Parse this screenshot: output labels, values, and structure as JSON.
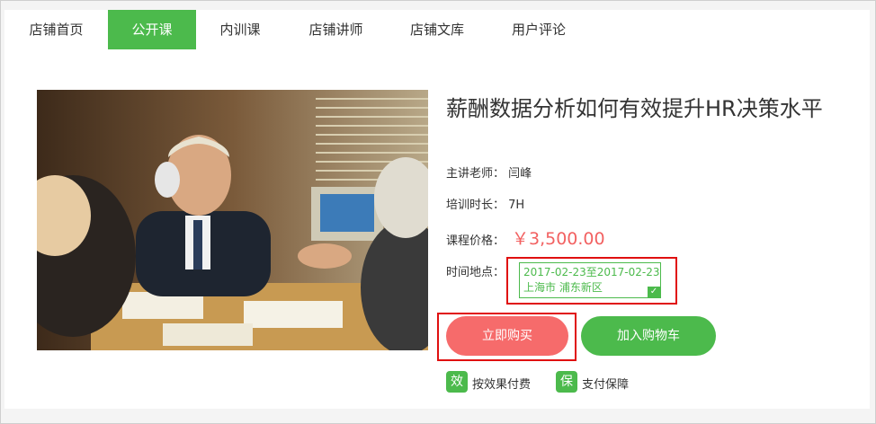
{
  "nav": {
    "tabs": [
      {
        "label": "店铺首页"
      },
      {
        "label": "公开课"
      },
      {
        "label": "内训课"
      },
      {
        "label": "店铺讲师"
      },
      {
        "label": "店铺文库"
      },
      {
        "label": "用户评论"
      }
    ],
    "active_index": 1
  },
  "course": {
    "title": "薪酬数据分析如何有效提升HR决策水平",
    "teacher_label": "主讲老师：",
    "teacher_name": "闫峰",
    "duration_label": "培训时长：",
    "duration_value": "7H",
    "price_label": "课程价格：",
    "price_value": "￥3,500.00",
    "session_label": "时间地点：",
    "session_dates": "2017-02-23至2017-02-23",
    "session_location": "上海市 浦东新区",
    "image_alt": "business meeting photo"
  },
  "actions": {
    "buy_label": "立即购买",
    "cart_label": "加入购物车"
  },
  "guarantees": [
    {
      "badge": "效",
      "label": "按效果付费"
    },
    {
      "badge": "保",
      "label": "支付保障"
    }
  ],
  "colors": {
    "accent_green": "#4cba4c",
    "price_red": "#f26161",
    "buy_button": "#f66b6b",
    "highlight_red": "#e01010"
  }
}
